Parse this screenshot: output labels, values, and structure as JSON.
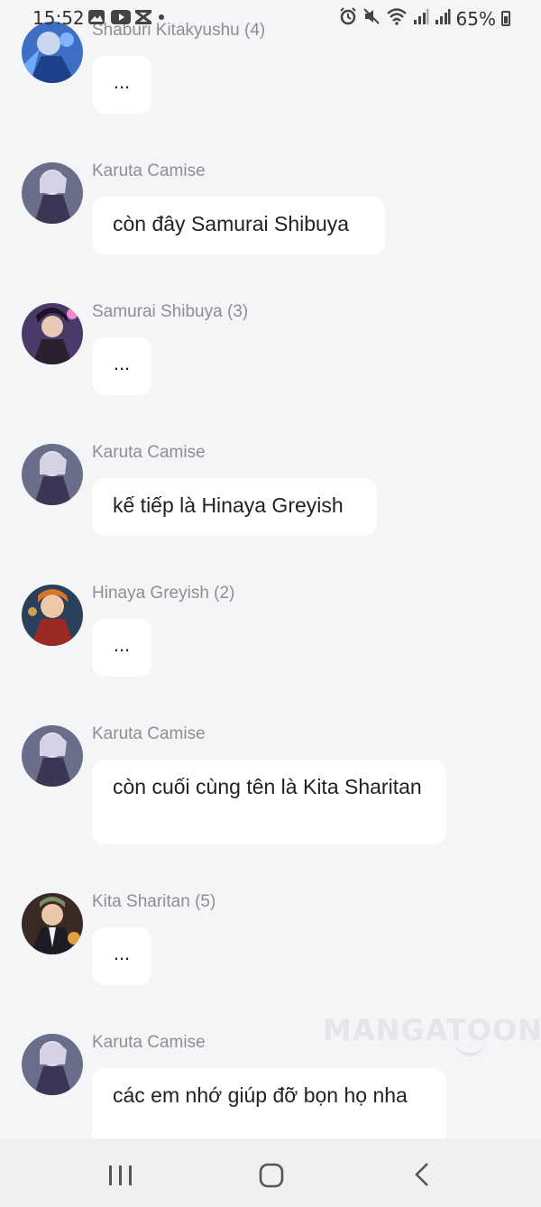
{
  "status_bar": {
    "time": "15:52",
    "battery": "65%",
    "left_icons": [
      "gallery-icon",
      "youtube-icon",
      "capcut-icon",
      "dot-icon"
    ],
    "right_icons": [
      "alarm-icon",
      "mute-icon",
      "wifi-icon",
      "signal-icon",
      "signal-icon",
      "battery-icon"
    ]
  },
  "messages": [
    {
      "sender": "Shaburi Kitakyushu (4)",
      "text": "...",
      "avatar": "shaburi-avatar"
    },
    {
      "sender": "Karuta Camise",
      "text": "còn đây Samurai Shibuya",
      "avatar": "karuta-avatar"
    },
    {
      "sender": "Samurai Shibuya (3)",
      "text": "...",
      "avatar": "samurai-avatar"
    },
    {
      "sender": "Karuta Camise",
      "text": "kế tiếp là Hinaya Greyish",
      "avatar": "karuta-avatar"
    },
    {
      "sender": "Hinaya Greyish (2)",
      "text": "...",
      "avatar": "hinaya-avatar"
    },
    {
      "sender": "Karuta Camise",
      "text": "còn cuối cùng tên là Kita Sharitan",
      "avatar": "karuta-avatar"
    },
    {
      "sender": "Kita Sharitan (5)",
      "text": "...",
      "avatar": "kita-avatar"
    },
    {
      "sender": "Karuta Camise",
      "text": "các em nhớ giúp đỡ bọn họ nha",
      "avatar": "karuta-avatar"
    }
  ],
  "watermark": "MANGATOON",
  "nav": {
    "recents": "recents-icon",
    "home": "home-icon",
    "back": "back-icon"
  },
  "colors": {
    "background": "#f4f5f7",
    "bubble": "#ffffff",
    "sender": "#8e8e93",
    "text": "#222222"
  }
}
